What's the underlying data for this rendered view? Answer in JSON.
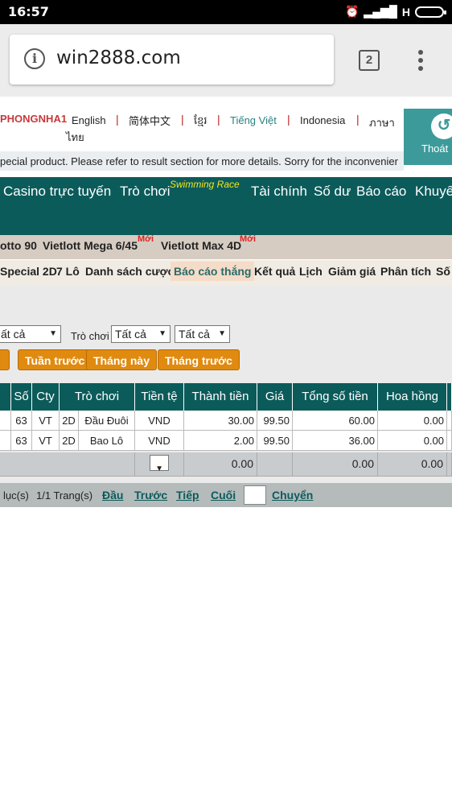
{
  "status_bar": {
    "time": "16:57",
    "network": "H"
  },
  "browser": {
    "url": "win2888.com",
    "tab_count": "2"
  },
  "lang_bar": {
    "brand": "PHONGNHA1",
    "languages": [
      "English",
      "简体中文",
      "ខ្មែរ",
      "Tiếng Việt",
      "Indonesia",
      "ภาษา",
      "ไทย"
    ],
    "logout_label": "Thoát"
  },
  "notice": "pecial product. Please refer to result section for more details. Sorry for the inconvenier",
  "main_nav": {
    "items": [
      "Casino trực tuyến",
      "Trò chơi",
      "Tài chính",
      "Số dư",
      "Báo cáo",
      "Khuyế"
    ],
    "superscript": "Swimming Race"
  },
  "lottery_nav": {
    "items": [
      "otto 90",
      "Vietlott Mega 6/45",
      "Vietlott Max 4D"
    ],
    "new_badge": "Mới"
  },
  "sub_nav": {
    "items": [
      "Special 2D",
      "7 Lô",
      "Danh sách cược",
      "Báo cáo thắng",
      "Kết quả",
      "Lịch",
      "Giảm giá",
      "Phân tích",
      "Số"
    ],
    "active": "Báo cáo thắng"
  },
  "filters": {
    "select1": "ất cả",
    "game_label": "Trò chơi",
    "select2": "Tất cả",
    "select3": "Tất cả",
    "buttons": [
      "",
      "Tuần trước",
      "Tháng này",
      "Tháng trước"
    ]
  },
  "table": {
    "headers": [
      "",
      "Số",
      "Cty",
      "Trò chơi",
      "Tiền tệ",
      "Thành tiền",
      "Giá",
      "Tổng số tiền",
      "Hoa hồng"
    ],
    "rows": [
      {
        "so": "63",
        "cty": "VT",
        "type": "2D",
        "game": "Đầu Đuôi",
        "currency": "VND",
        "amount": "30.00",
        "price": "99.50",
        "total": "60.00",
        "commission": "0.00"
      },
      {
        "so": "63",
        "cty": "VT",
        "type": "2D",
        "game": "Bao Lô",
        "currency": "VND",
        "amount": "2.00",
        "price": "99.50",
        "total": "36.00",
        "commission": "0.00"
      }
    ],
    "totals": {
      "amount": "0.00",
      "total": "0.00",
      "commission": "0.00"
    }
  },
  "pager": {
    "records": "lục(s)",
    "pages": "1/1 Trang(s)",
    "first": "Đầu",
    "prev": "Trước",
    "next": "Tiếp",
    "last": "Cuối",
    "go": "Chuyển"
  }
}
